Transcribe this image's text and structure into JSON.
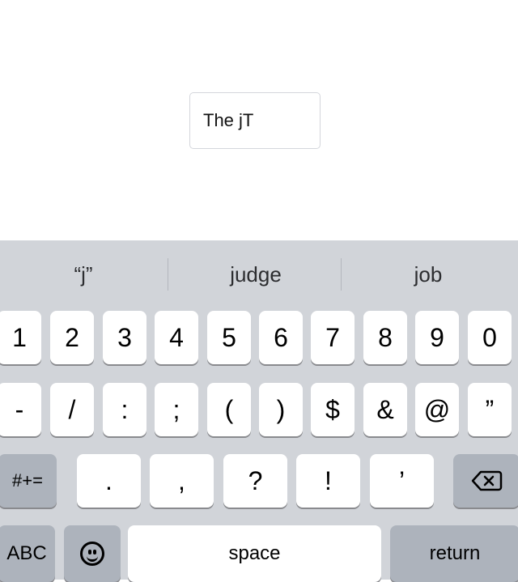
{
  "text_field": {
    "value": "The jT"
  },
  "suggestions": [
    "“j”",
    "judge",
    "job"
  ],
  "number_row": [
    "1",
    "2",
    "3",
    "4",
    "5",
    "6",
    "7",
    "8",
    "9",
    "0"
  ],
  "symbol_row": [
    "-",
    "/",
    ":",
    ";",
    "(",
    ")",
    "$",
    "&",
    "@",
    "”"
  ],
  "punct_row": {
    "mode_switch": "#+=",
    "keys": [
      ".",
      ",",
      "?",
      "!",
      "’"
    ],
    "delete_icon": "backspace-icon"
  },
  "bottom_row": {
    "abc": "ABC",
    "emoji_icon": "emoji-icon",
    "space": "space",
    "return": "return"
  },
  "colors": {
    "keyboard_bg": "#d1d4d9",
    "key_bg": "#ffffff",
    "dark_key_bg": "#adb3bc"
  }
}
